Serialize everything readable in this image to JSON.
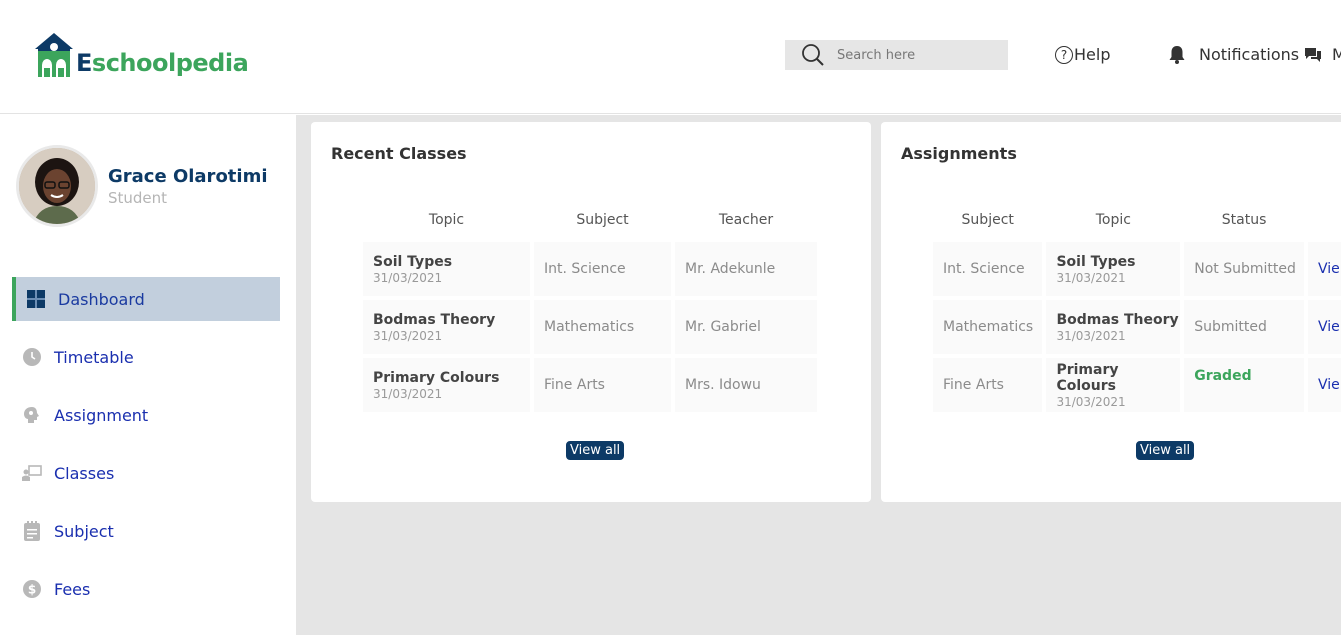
{
  "brand": {
    "logo_first_letter": "E",
    "logo_rest": "schoolpedia"
  },
  "header": {
    "search_placeholder": "Search here",
    "help_icon_glyph": "?",
    "help_label": "Help",
    "notifications_label": "Notifications",
    "messages_label": "M"
  },
  "profile": {
    "name": "Grace Olarotimi",
    "role": "Student"
  },
  "sidebar": {
    "items": [
      {
        "label": "Dashboard",
        "icon": "dashboard-icon",
        "active": true
      },
      {
        "label": "Timetable",
        "icon": "clock-icon"
      },
      {
        "label": "Assignment",
        "icon": "brain-icon"
      },
      {
        "label": "Classes",
        "icon": "classroom-icon"
      },
      {
        "label": "Subject",
        "icon": "notepad-icon"
      },
      {
        "label": "Fees",
        "icon": "dollar-icon"
      }
    ]
  },
  "recent_classes": {
    "title": "Recent Classes",
    "headers": [
      "Topic",
      "Subject",
      "Teacher"
    ],
    "rows": [
      {
        "topic": "Soil Types",
        "date": "31/03/2021",
        "subject": "Int. Science",
        "teacher": "Mr. Adekunle"
      },
      {
        "topic": "Bodmas Theory",
        "date": "31/03/2021",
        "subject": "Mathematics",
        "teacher": "Mr. Gabriel"
      },
      {
        "topic": "Primary Colours",
        "date": "31/03/2021",
        "subject": "Fine Arts",
        "teacher": "Mrs. Idowu"
      }
    ],
    "view_all": "View all"
  },
  "assignments": {
    "title": "Assignments",
    "headers": [
      "Subject",
      "Topic",
      "Status"
    ],
    "rows": [
      {
        "subject": "Int. Science",
        "topic": "Soil Types",
        "date": "31/03/2021",
        "status": "Not Submitted",
        "action": "Vie"
      },
      {
        "subject": "Mathematics",
        "topic": "Bodmas Theory",
        "date": "31/03/2021",
        "status": "Submitted",
        "action": "Vie"
      },
      {
        "subject": "Fine Arts",
        "topic": "Primary Colours",
        "date": "31/03/2021",
        "status": "Graded",
        "action": "Vie"
      }
    ],
    "view_all": "View all"
  },
  "colors": {
    "brand_navy": "#0d3a66",
    "brand_green": "#3ca55c",
    "nav_text": "#1a2faf",
    "active_bg": "#c2cfdd"
  }
}
